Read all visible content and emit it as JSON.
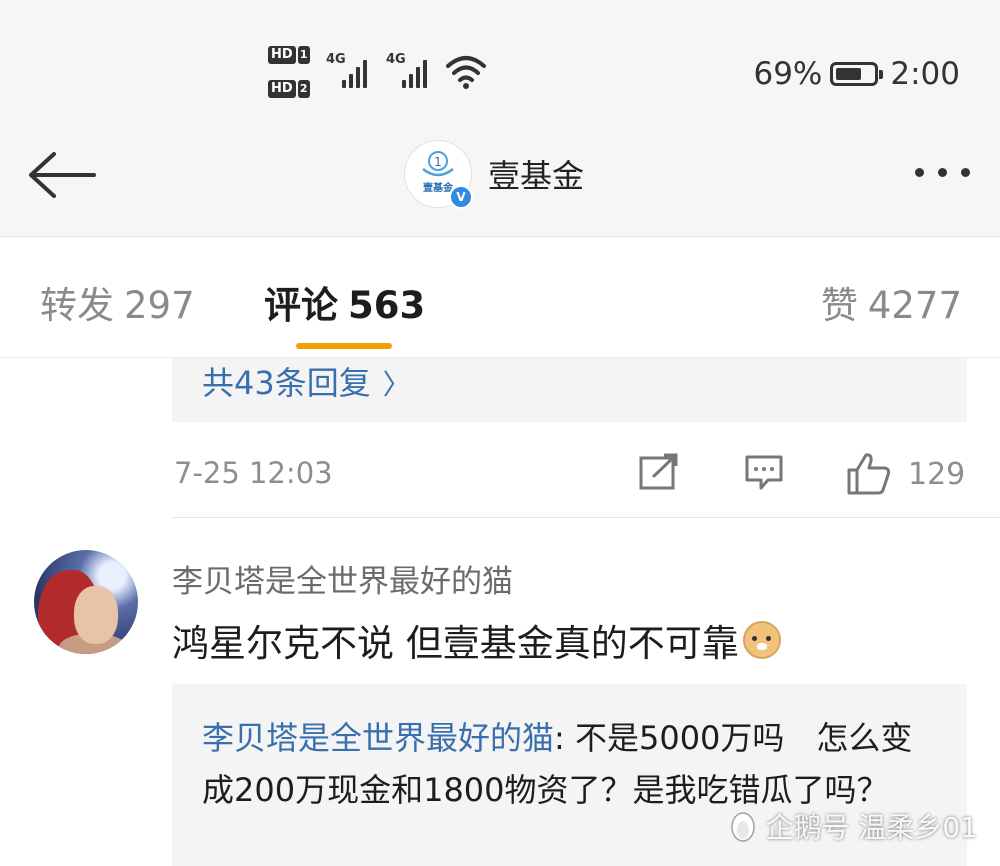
{
  "status_bar": {
    "sim1_label": "HD",
    "sim1_num": "1",
    "sim2_label": "HD",
    "sim2_num": "2",
    "network1": "4G",
    "network2": "4G",
    "battery_percent": "69%",
    "battery_level": 0.69,
    "time": "2:00"
  },
  "nav": {
    "account_name": "壹基金",
    "account_logo_text": "壹基金",
    "verified_badge": "V"
  },
  "tabs": [
    {
      "label": "转发",
      "count": "297"
    },
    {
      "label": "评论",
      "count": "563",
      "active": true
    },
    {
      "label": "赞",
      "count": "4277"
    }
  ],
  "previous_comment": {
    "more_replies": "共43条回复",
    "timestamp": "7-25 12:03",
    "like_count": "129"
  },
  "comment": {
    "username": "李贝塔是全世界最好的猫",
    "text": "鸿星尔克不说 但壹基金真的不可靠",
    "emoji": "doge",
    "reply": {
      "username": "李贝塔是全世界最好的猫",
      "text": ": 不是5000万吗　怎么变成200万现金和1800物资了？是我吃错瓜了吗？"
    }
  },
  "watermark": "企鹅号 温柔乡01",
  "colors": {
    "accent_underline": "#f0a000",
    "link_blue": "#3a6fae",
    "verified_blue": "#2f8ae0"
  }
}
